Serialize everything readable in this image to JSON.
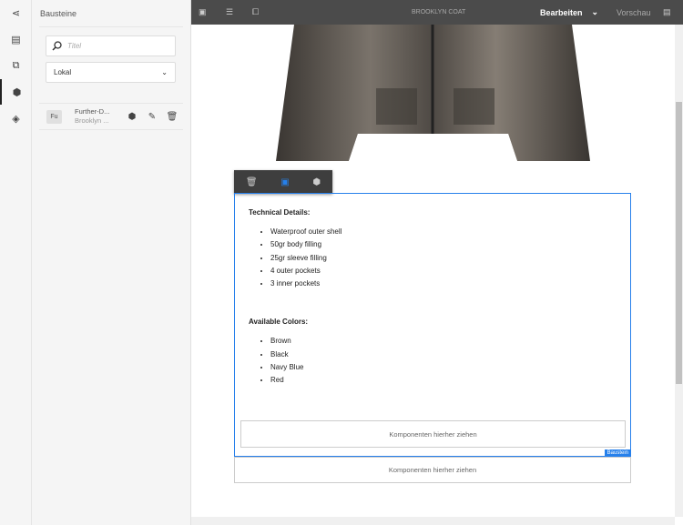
{
  "rail": {
    "icons": [
      "share-icon",
      "page-info-icon",
      "assets-icon",
      "components-icon",
      "layers-icon"
    ]
  },
  "panel": {
    "title": "Bausteine",
    "search_placeholder": "Titel",
    "filter_value": "Lokal",
    "items": [
      {
        "badge": "Fu",
        "title": "Further-D...",
        "subtitle": "Brooklyn ..."
      }
    ]
  },
  "topbar": {
    "page_title": "BROOKLYN COAT",
    "mode": "Bearbeiten",
    "preview": "Vorschau"
  },
  "content": {
    "heading1": "Technical Details:",
    "details": [
      "Waterproof outer shell",
      "50gr body filling",
      "25gr sleeve filling",
      "4 outer pockets",
      "3 inner pockets"
    ],
    "heading2": "Available Colors:",
    "colors": [
      "Brown",
      "Black",
      "Navy Blue",
      "Red"
    ],
    "drop_inner": "Komponenten hierher ziehen",
    "drop_outer": "Komponenten hierher ziehen",
    "tag": "Baustein"
  },
  "colors": {
    "accent": "#2680eb",
    "topbar": "#4b4b4b"
  }
}
